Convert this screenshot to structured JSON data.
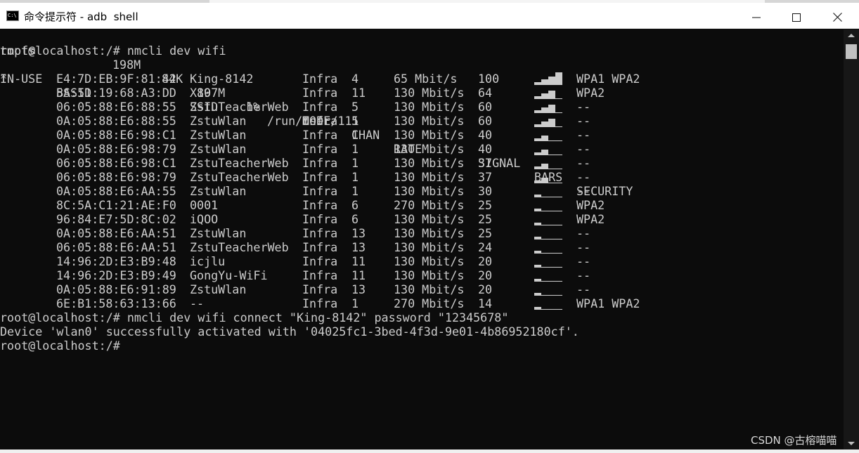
{
  "window": {
    "title": "命令提示符 - adb  shell",
    "icon_text": "C:\\"
  },
  "terminal": {
    "df_line": {
      "fs": "tmpfs",
      "size": "198M",
      "used": "84K",
      "avail": "197M",
      "use_pct": "1%",
      "mount": "/run/user/111"
    },
    "cmd1": "root@localhost:/# nmcli dev wifi",
    "headers": {
      "in_use": "IN-USE",
      "bssid": "BSSID",
      "ssid": "SSID",
      "mode": "MODE",
      "chan": "CHAN",
      "rate": "RATE",
      "signal": "SIGNAL",
      "bars": "BARS",
      "security": "SECURITY"
    },
    "networks": [
      {
        "in_use": "*",
        "bssid": "E4:7D:EB:9F:81:42",
        "ssid": "King-8142",
        "mode": "Infra",
        "chan": "4",
        "rate": "65 Mbit/s",
        "signal": "100",
        "bars_level": 4,
        "security": "WPA1 WPA2"
      },
      {
        "in_use": "",
        "bssid": "5A:51:19:68:A3:DD",
        "ssid": "X80",
        "mode": "Infra",
        "chan": "11",
        "rate": "130 Mbit/s",
        "signal": "64",
        "bars_level": 3,
        "security": "WPA2"
      },
      {
        "in_use": "",
        "bssid": "06:05:88:E6:88:55",
        "ssid": "ZstuTeacherWeb",
        "mode": "Infra",
        "chan": "5",
        "rate": "130 Mbit/s",
        "signal": "60",
        "bars_level": 3,
        "security": "--"
      },
      {
        "in_use": "",
        "bssid": "0A:05:88:E6:88:55",
        "ssid": "ZstuWlan",
        "mode": "Infra",
        "chan": "5",
        "rate": "130 Mbit/s",
        "signal": "60",
        "bars_level": 3,
        "security": "--"
      },
      {
        "in_use": "",
        "bssid": "0A:05:88:E6:98:C1",
        "ssid": "ZstuWlan",
        "mode": "Infra",
        "chan": "1",
        "rate": "130 Mbit/s",
        "signal": "40",
        "bars_level": 2,
        "security": "--"
      },
      {
        "in_use": "",
        "bssid": "0A:05:88:E6:98:79",
        "ssid": "ZstuWlan",
        "mode": "Infra",
        "chan": "1",
        "rate": "130 Mbit/s",
        "signal": "40",
        "bars_level": 2,
        "security": "--"
      },
      {
        "in_use": "",
        "bssid": "06:05:88:E6:98:C1",
        "ssid": "ZstuTeacherWeb",
        "mode": "Infra",
        "chan": "1",
        "rate": "130 Mbit/s",
        "signal": "37",
        "bars_level": 2,
        "security": "--"
      },
      {
        "in_use": "",
        "bssid": "06:05:88:E6:98:79",
        "ssid": "ZstuTeacherWeb",
        "mode": "Infra",
        "chan": "1",
        "rate": "130 Mbit/s",
        "signal": "37",
        "bars_level": 2,
        "security": "--"
      },
      {
        "in_use": "",
        "bssid": "0A:05:88:E6:AA:55",
        "ssid": "ZstuWlan",
        "mode": "Infra",
        "chan": "1",
        "rate": "130 Mbit/s",
        "signal": "30",
        "bars_level": 1,
        "security": "--"
      },
      {
        "in_use": "",
        "bssid": "8C:5A:C1:21:AE:F0",
        "ssid": "0001",
        "mode": "Infra",
        "chan": "6",
        "rate": "270 Mbit/s",
        "signal": "25",
        "bars_level": 1,
        "security": "WPA2"
      },
      {
        "in_use": "",
        "bssid": "96:84:E7:5D:8C:02",
        "ssid": "iQOO",
        "mode": "Infra",
        "chan": "6",
        "rate": "130 Mbit/s",
        "signal": "25",
        "bars_level": 1,
        "security": "WPA2"
      },
      {
        "in_use": "",
        "bssid": "0A:05:88:E6:AA:51",
        "ssid": "ZstuWlan",
        "mode": "Infra",
        "chan": "13",
        "rate": "130 Mbit/s",
        "signal": "25",
        "bars_level": 1,
        "security": "--"
      },
      {
        "in_use": "",
        "bssid": "06:05:88:E6:AA:51",
        "ssid": "ZstuTeacherWeb",
        "mode": "Infra",
        "chan": "13",
        "rate": "130 Mbit/s",
        "signal": "24",
        "bars_level": 1,
        "security": "--"
      },
      {
        "in_use": "",
        "bssid": "14:96:2D:E3:B9:48",
        "ssid": "icjlu",
        "mode": "Infra",
        "chan": "11",
        "rate": "130 Mbit/s",
        "signal": "20",
        "bars_level": 1,
        "security": "--"
      },
      {
        "in_use": "",
        "bssid": "14:96:2D:E3:B9:49",
        "ssid": "GongYu-WiFi",
        "mode": "Infra",
        "chan": "11",
        "rate": "130 Mbit/s",
        "signal": "20",
        "bars_level": 1,
        "security": "--"
      },
      {
        "in_use": "",
        "bssid": "0A:05:88:E6:91:89",
        "ssid": "ZstuWlan",
        "mode": "Infra",
        "chan": "13",
        "rate": "130 Mbit/s",
        "signal": "20",
        "bars_level": 1,
        "security": "--"
      },
      {
        "in_use": "",
        "bssid": "6E:B1:58:63:13:66",
        "ssid": "--",
        "mode": "Infra",
        "chan": "1",
        "rate": "270 Mbit/s",
        "signal": "14",
        "bars_level": 1,
        "security": "WPA1 WPA2"
      }
    ],
    "cmd2": "root@localhost:/# nmcli dev wifi connect \"King-8142\" password \"12345678\"",
    "result": "Device 'wlan0' successfully activated with '04025fc1-3bed-4f3d-9e01-4b86952180cf'.",
    "prompt": "root@localhost:/# ",
    "text_color": "#cccccc",
    "background": "#0c0c0c"
  },
  "watermark": "CSDN @古榕喵喵"
}
